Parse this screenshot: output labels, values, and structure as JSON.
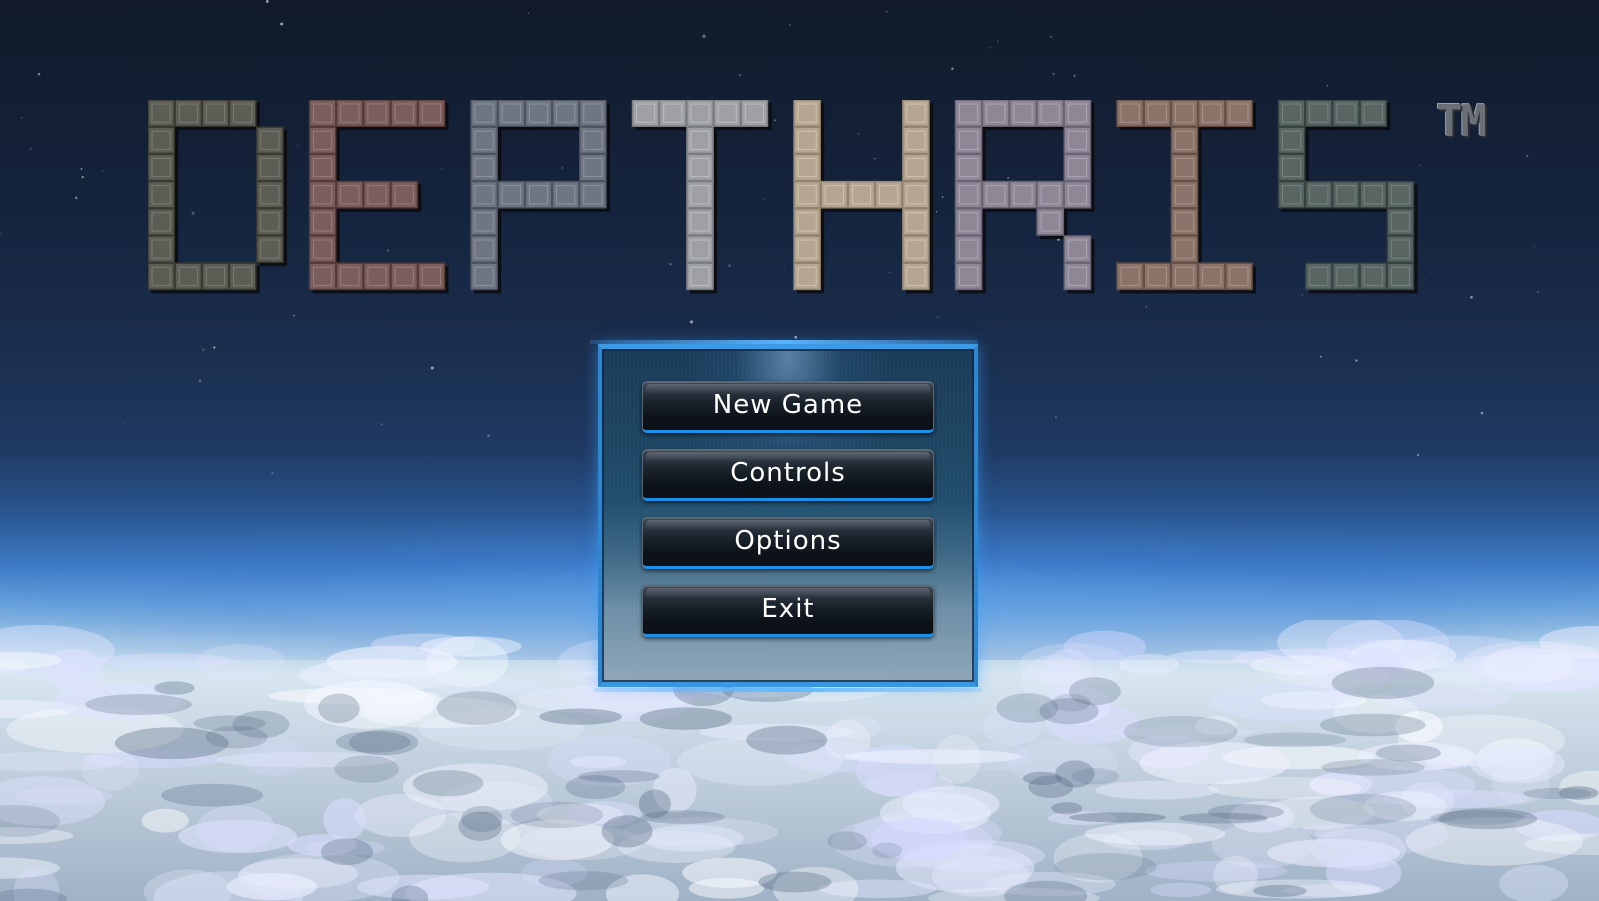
{
  "game": {
    "title": "DEPTHRIS",
    "trademark": "TM"
  },
  "logo": {
    "letters": [
      {
        "char": "D",
        "color": "#5c5d55"
      },
      {
        "char": "E",
        "color": "#7a5e5c"
      },
      {
        "char": "P",
        "color": "#6f7682"
      },
      {
        "char": "T",
        "color": "#9ea0a3"
      },
      {
        "char": "H",
        "color": "#b4a690"
      },
      {
        "char": "R",
        "color": "#8e8796"
      },
      {
        "char": "I",
        "color": "#8a7469"
      },
      {
        "char": "S",
        "color": "#586563"
      }
    ]
  },
  "menu": {
    "buttons": [
      {
        "id": "new-game",
        "label": "New Game"
      },
      {
        "id": "controls",
        "label": "Controls"
      },
      {
        "id": "options",
        "label": "Options"
      },
      {
        "id": "exit",
        "label": "Exit"
      }
    ]
  },
  "colors": {
    "frame_accent": "#2d86d0",
    "button_underline": "#1e8fe8",
    "button_text": "#ffffff"
  }
}
